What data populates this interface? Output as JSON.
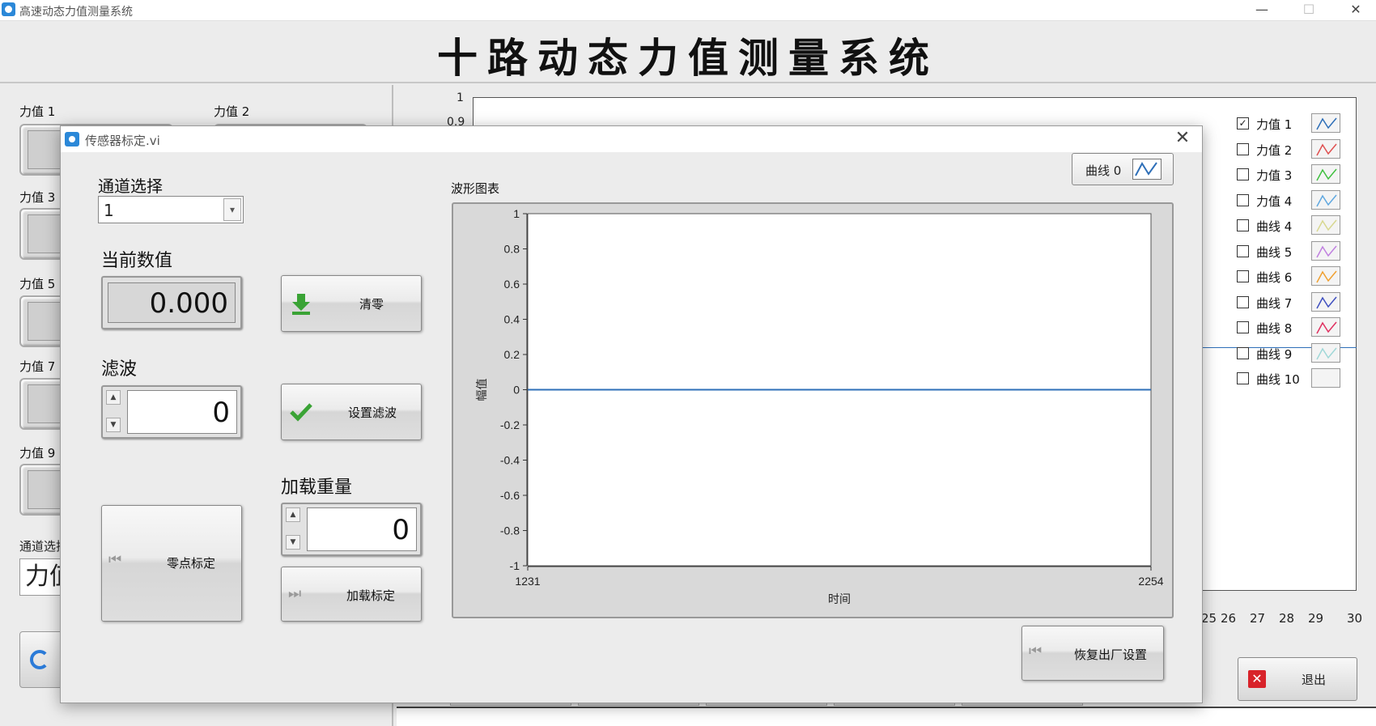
{
  "main_window": {
    "title": "高速动态力值测量系统",
    "minimize": "—",
    "maximize": "☐",
    "close": "✕",
    "header_title": "十路动态力值测量系统",
    "left_labels": [
      "力值 1",
      "力值 2",
      "力值 3",
      "力值 5",
      "力值 7",
      "力值 9"
    ],
    "channel_label": "通道选择",
    "channel_value": "力值",
    "exit_label": "退出",
    "bg_y_ticks": [
      "1",
      "0.9"
    ],
    "bg_x_ticks": [
      "25",
      "26",
      "27",
      "28",
      "29",
      "30"
    ],
    "legend": [
      {
        "label": "力值 1",
        "checked": true,
        "color": "#2e6fb8"
      },
      {
        "label": "力值 2",
        "checked": false,
        "color": "#e05050"
      },
      {
        "label": "力值 3",
        "checked": false,
        "color": "#40c040"
      },
      {
        "label": "力值 4",
        "checked": false,
        "color": "#60a8e0"
      },
      {
        "label": "曲线 4",
        "checked": false,
        "color": "#d8d890"
      },
      {
        "label": "曲线 5",
        "checked": false,
        "color": "#c080e0"
      },
      {
        "label": "曲线 6",
        "checked": false,
        "color": "#f0a030"
      },
      {
        "label": "曲线 7",
        "checked": false,
        "color": "#4050c0"
      },
      {
        "label": "曲线 8",
        "checked": false,
        "color": "#e03060"
      },
      {
        "label": "曲线 9",
        "checked": false,
        "color": "#a0d8d8"
      },
      {
        "label": "曲线 10",
        "checked": false,
        "color": ""
      }
    ]
  },
  "dialog": {
    "title": "传感器标定.vi",
    "close": "✕",
    "channel_select_label": "通道选择",
    "channel_select_value": "1",
    "current_value_label": "当前数值",
    "current_value": "0.000",
    "clear_button": "清零",
    "filter_label": "滤波",
    "filter_value": "0",
    "set_filter_button": "设置滤波",
    "zero_cal_button": "零点标定",
    "load_weight_label": "加载重量",
    "load_weight_value": "0",
    "load_cal_button": "加载标定",
    "restore_button": "恢复出厂设置",
    "chart_caption": "波形图表",
    "curve_legend": "曲线 0"
  },
  "chart_data": {
    "type": "line",
    "title": "波形图表",
    "xlabel": "时间",
    "ylabel": "幅值",
    "xlim": [
      1231,
      2254
    ],
    "ylim": [
      -1,
      1
    ],
    "y_ticks": [
      1,
      0.8,
      0.6,
      0.4,
      0.2,
      0,
      -0.2,
      -0.4,
      -0.6,
      -0.8,
      -1
    ],
    "x_ticks": [
      1231,
      2254
    ],
    "series": [
      {
        "name": "曲线 0",
        "color": "#2e6fb8",
        "x": [
          1231,
          2254
        ],
        "y": [
          0,
          0
        ]
      }
    ],
    "grid": false,
    "legend": "top-right"
  }
}
